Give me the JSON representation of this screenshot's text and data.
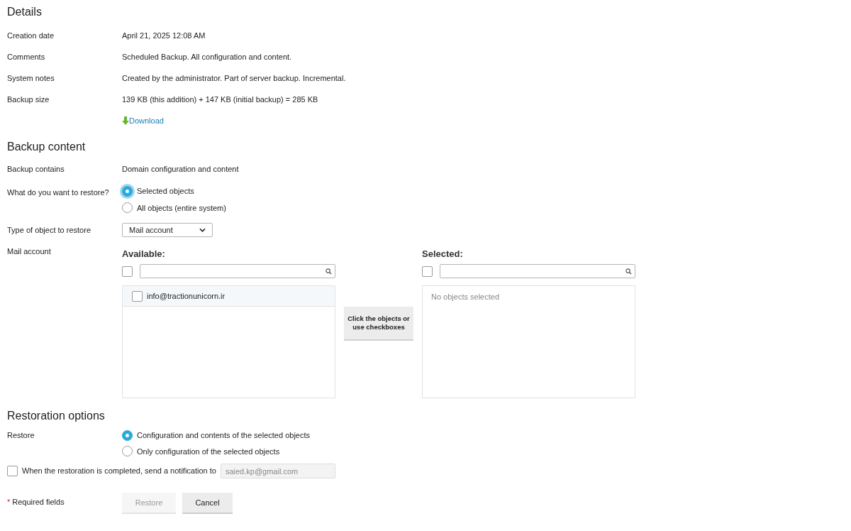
{
  "details": {
    "title": "Details",
    "rows": [
      {
        "label": "Creation date",
        "value": "April 21, 2025 12:08 AM"
      },
      {
        "label": "Comments",
        "value": "Scheduled Backup. All configuration and content."
      },
      {
        "label": "System notes",
        "value": "Created by the administrator. Part of server backup. Incremental."
      },
      {
        "label": "Backup size",
        "value": "139 KB (this addition) + 147 KB (initial backup) = 285 KB"
      }
    ],
    "download": "Download"
  },
  "backup_content": {
    "title": "Backup content",
    "contains_label": "Backup contains",
    "contains_value": "Domain configuration and content",
    "restore_what": {
      "label": "What do you want to restore?",
      "options": [
        {
          "label": "Selected objects",
          "selected": true,
          "focused": true
        },
        {
          "label": "All objects (entire system)",
          "selected": false,
          "focused": false
        }
      ]
    },
    "object_type": {
      "label": "Type of object to restore",
      "value": "Mail account"
    },
    "mail_account": {
      "label": "Mail account",
      "available": {
        "title": "Available:",
        "select_all": false,
        "items": [
          {
            "label": "info@tractionunicorn.ir",
            "checked": false
          }
        ]
      },
      "move_hint": "Click the objects or use checkboxes",
      "selected": {
        "title": "Selected:",
        "select_all": false,
        "empty": "No objects selected"
      }
    }
  },
  "restoration_options": {
    "title": "Restoration options",
    "restore_label": "Restore",
    "options": [
      {
        "label": "Configuration and contents of the selected objects",
        "selected": true
      },
      {
        "label": "Only configuration of the selected objects",
        "selected": false
      }
    ],
    "notify": {
      "checked": false,
      "label": "When the restoration is completed, send a notification to",
      "value": "saied.kp@gmail.com",
      "disabled": true
    }
  },
  "footer": {
    "required_mark": "*",
    "required_text": "Required fields",
    "buttons": [
      {
        "label": "Restore",
        "disabled": true
      },
      {
        "label": "Cancel",
        "disabled": false
      }
    ]
  }
}
